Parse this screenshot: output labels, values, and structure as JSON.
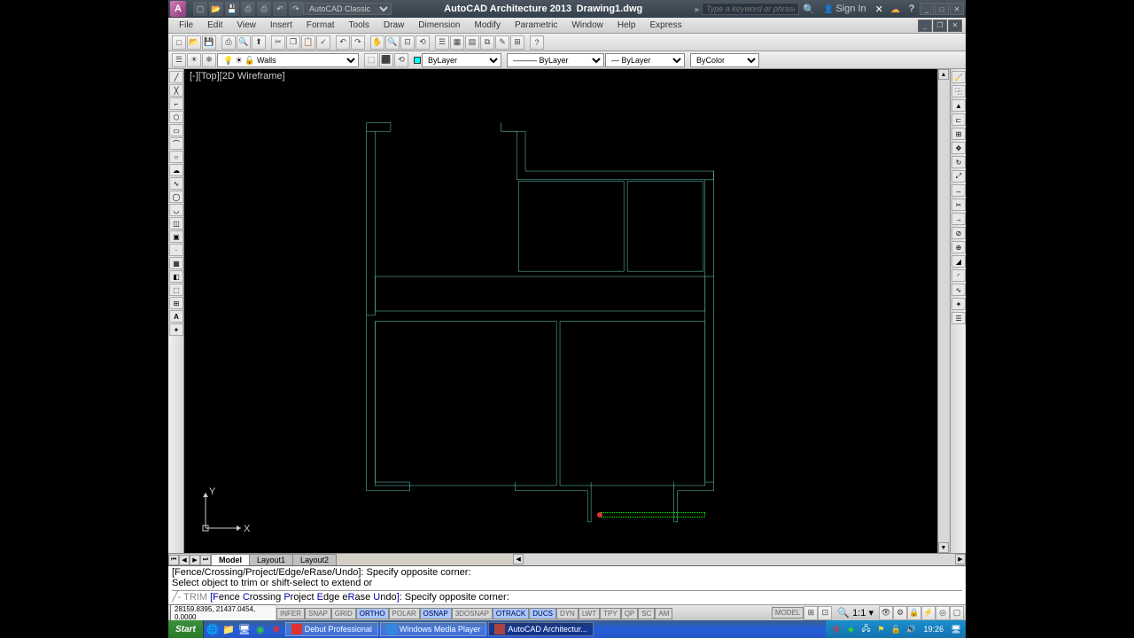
{
  "app": {
    "title_left": "AutoCAD Architecture 2013",
    "title_right": "Drawing1.dwg",
    "workspace": "AutoCAD Classic",
    "search_placeholder": "Type a keyword or phrase",
    "signin": "Sign In"
  },
  "menu": [
    "File",
    "Edit",
    "View",
    "Insert",
    "Format",
    "Tools",
    "Draw",
    "Dimension",
    "Modify",
    "Parametric",
    "Window",
    "Help",
    "Express"
  ],
  "layer_panel": {
    "current_layer": "Walls",
    "linetype": "ByLayer",
    "lineweight": "ByLayer",
    "color_mode": "ByColor"
  },
  "viewport": {
    "label_open": "[-]",
    "view": "[Top]",
    "style": "[2D Wireframe]"
  },
  "ucs": {
    "x": "X",
    "y": "Y"
  },
  "tabs": {
    "model": "Model",
    "layout1": "Layout1",
    "layout2": "Layout2"
  },
  "command": {
    "line1_prefix": "[Fence/Crossing/Project/Edge/eRase/Undo]: ",
    "line1_msg": "Specify opposite corner:",
    "line2": "Select object to trim or shift-select to extend or",
    "prompt_cmd": "TRIM",
    "prompt_opts": "[Fence Crossing Project Edge eRase Undo]",
    "prompt_suffix": ": ",
    "prompt_msg": "Specify opposite corner:"
  },
  "status": {
    "coords": "28159.8395, 21437.0454, 0.0000",
    "toggles": [
      "INFER",
      "SNAP",
      "GRID",
      "ORTHO",
      "POLAR",
      "OSNAP",
      "3DOSNAP",
      "OTRACK",
      "DUCS",
      "DYN",
      "LWT",
      "TPY",
      "QP",
      "SC",
      "AM"
    ],
    "on": [
      "ORTHO",
      "OSNAP",
      "OTRACK",
      "DUCS"
    ],
    "right_label": "MODEL",
    "scale": "1:1"
  },
  "taskbar": {
    "start": "Start",
    "apps": [
      {
        "name": "Debut Professional",
        "icon_color": "#d33"
      },
      {
        "name": "Windows Media Player",
        "icon_color": "#38d"
      },
      {
        "name": "AutoCAD Architectur...",
        "icon_color": "#a44"
      }
    ],
    "clock": "19:26"
  }
}
